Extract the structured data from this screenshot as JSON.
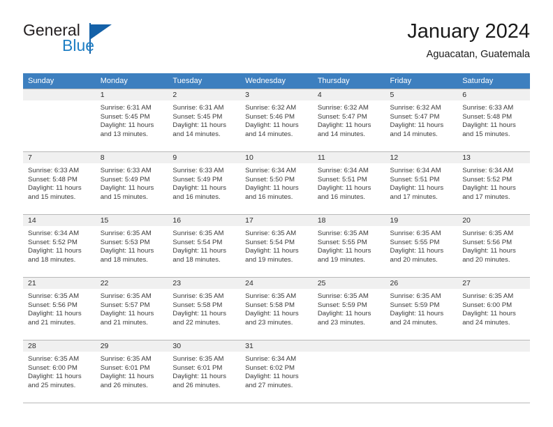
{
  "brand": {
    "name_part1": "General",
    "name_part2": "Blue",
    "logo_icon": "triangle-flag-icon"
  },
  "header": {
    "title": "January 2024",
    "location": "Aguacatan, Guatemala"
  },
  "calendar": {
    "weekday_headers": [
      "Sunday",
      "Monday",
      "Tuesday",
      "Wednesday",
      "Thursday",
      "Friday",
      "Saturday"
    ],
    "accent_color": "#3d7fbf",
    "daynum_strip_color": "#f0f0f0",
    "border_color": "#b8b8b8",
    "weeks": [
      [
        {
          "day": "",
          "sunrise": "",
          "sunset": "",
          "daylight_line1": "",
          "daylight_line2": ""
        },
        {
          "day": "1",
          "sunrise": "Sunrise: 6:31 AM",
          "sunset": "Sunset: 5:45 PM",
          "daylight_line1": "Daylight: 11 hours",
          "daylight_line2": "and 13 minutes."
        },
        {
          "day": "2",
          "sunrise": "Sunrise: 6:31 AM",
          "sunset": "Sunset: 5:45 PM",
          "daylight_line1": "Daylight: 11 hours",
          "daylight_line2": "and 14 minutes."
        },
        {
          "day": "3",
          "sunrise": "Sunrise: 6:32 AM",
          "sunset": "Sunset: 5:46 PM",
          "daylight_line1": "Daylight: 11 hours",
          "daylight_line2": "and 14 minutes."
        },
        {
          "day": "4",
          "sunrise": "Sunrise: 6:32 AM",
          "sunset": "Sunset: 5:47 PM",
          "daylight_line1": "Daylight: 11 hours",
          "daylight_line2": "and 14 minutes."
        },
        {
          "day": "5",
          "sunrise": "Sunrise: 6:32 AM",
          "sunset": "Sunset: 5:47 PM",
          "daylight_line1": "Daylight: 11 hours",
          "daylight_line2": "and 14 minutes."
        },
        {
          "day": "6",
          "sunrise": "Sunrise: 6:33 AM",
          "sunset": "Sunset: 5:48 PM",
          "daylight_line1": "Daylight: 11 hours",
          "daylight_line2": "and 15 minutes."
        }
      ],
      [
        {
          "day": "7",
          "sunrise": "Sunrise: 6:33 AM",
          "sunset": "Sunset: 5:48 PM",
          "daylight_line1": "Daylight: 11 hours",
          "daylight_line2": "and 15 minutes."
        },
        {
          "day": "8",
          "sunrise": "Sunrise: 6:33 AM",
          "sunset": "Sunset: 5:49 PM",
          "daylight_line1": "Daylight: 11 hours",
          "daylight_line2": "and 15 minutes."
        },
        {
          "day": "9",
          "sunrise": "Sunrise: 6:33 AM",
          "sunset": "Sunset: 5:49 PM",
          "daylight_line1": "Daylight: 11 hours",
          "daylight_line2": "and 16 minutes."
        },
        {
          "day": "10",
          "sunrise": "Sunrise: 6:34 AM",
          "sunset": "Sunset: 5:50 PM",
          "daylight_line1": "Daylight: 11 hours",
          "daylight_line2": "and 16 minutes."
        },
        {
          "day": "11",
          "sunrise": "Sunrise: 6:34 AM",
          "sunset": "Sunset: 5:51 PM",
          "daylight_line1": "Daylight: 11 hours",
          "daylight_line2": "and 16 minutes."
        },
        {
          "day": "12",
          "sunrise": "Sunrise: 6:34 AM",
          "sunset": "Sunset: 5:51 PM",
          "daylight_line1": "Daylight: 11 hours",
          "daylight_line2": "and 17 minutes."
        },
        {
          "day": "13",
          "sunrise": "Sunrise: 6:34 AM",
          "sunset": "Sunset: 5:52 PM",
          "daylight_line1": "Daylight: 11 hours",
          "daylight_line2": "and 17 minutes."
        }
      ],
      [
        {
          "day": "14",
          "sunrise": "Sunrise: 6:34 AM",
          "sunset": "Sunset: 5:52 PM",
          "daylight_line1": "Daylight: 11 hours",
          "daylight_line2": "and 18 minutes."
        },
        {
          "day": "15",
          "sunrise": "Sunrise: 6:35 AM",
          "sunset": "Sunset: 5:53 PM",
          "daylight_line1": "Daylight: 11 hours",
          "daylight_line2": "and 18 minutes."
        },
        {
          "day": "16",
          "sunrise": "Sunrise: 6:35 AM",
          "sunset": "Sunset: 5:54 PM",
          "daylight_line1": "Daylight: 11 hours",
          "daylight_line2": "and 18 minutes."
        },
        {
          "day": "17",
          "sunrise": "Sunrise: 6:35 AM",
          "sunset": "Sunset: 5:54 PM",
          "daylight_line1": "Daylight: 11 hours",
          "daylight_line2": "and 19 minutes."
        },
        {
          "day": "18",
          "sunrise": "Sunrise: 6:35 AM",
          "sunset": "Sunset: 5:55 PM",
          "daylight_line1": "Daylight: 11 hours",
          "daylight_line2": "and 19 minutes."
        },
        {
          "day": "19",
          "sunrise": "Sunrise: 6:35 AM",
          "sunset": "Sunset: 5:55 PM",
          "daylight_line1": "Daylight: 11 hours",
          "daylight_line2": "and 20 minutes."
        },
        {
          "day": "20",
          "sunrise": "Sunrise: 6:35 AM",
          "sunset": "Sunset: 5:56 PM",
          "daylight_line1": "Daylight: 11 hours",
          "daylight_line2": "and 20 minutes."
        }
      ],
      [
        {
          "day": "21",
          "sunrise": "Sunrise: 6:35 AM",
          "sunset": "Sunset: 5:56 PM",
          "daylight_line1": "Daylight: 11 hours",
          "daylight_line2": "and 21 minutes."
        },
        {
          "day": "22",
          "sunrise": "Sunrise: 6:35 AM",
          "sunset": "Sunset: 5:57 PM",
          "daylight_line1": "Daylight: 11 hours",
          "daylight_line2": "and 21 minutes."
        },
        {
          "day": "23",
          "sunrise": "Sunrise: 6:35 AM",
          "sunset": "Sunset: 5:58 PM",
          "daylight_line1": "Daylight: 11 hours",
          "daylight_line2": "and 22 minutes."
        },
        {
          "day": "24",
          "sunrise": "Sunrise: 6:35 AM",
          "sunset": "Sunset: 5:58 PM",
          "daylight_line1": "Daylight: 11 hours",
          "daylight_line2": "and 23 minutes."
        },
        {
          "day": "25",
          "sunrise": "Sunrise: 6:35 AM",
          "sunset": "Sunset: 5:59 PM",
          "daylight_line1": "Daylight: 11 hours",
          "daylight_line2": "and 23 minutes."
        },
        {
          "day": "26",
          "sunrise": "Sunrise: 6:35 AM",
          "sunset": "Sunset: 5:59 PM",
          "daylight_line1": "Daylight: 11 hours",
          "daylight_line2": "and 24 minutes."
        },
        {
          "day": "27",
          "sunrise": "Sunrise: 6:35 AM",
          "sunset": "Sunset: 6:00 PM",
          "daylight_line1": "Daylight: 11 hours",
          "daylight_line2": "and 24 minutes."
        }
      ],
      [
        {
          "day": "28",
          "sunrise": "Sunrise: 6:35 AM",
          "sunset": "Sunset: 6:00 PM",
          "daylight_line1": "Daylight: 11 hours",
          "daylight_line2": "and 25 minutes."
        },
        {
          "day": "29",
          "sunrise": "Sunrise: 6:35 AM",
          "sunset": "Sunset: 6:01 PM",
          "daylight_line1": "Daylight: 11 hours",
          "daylight_line2": "and 26 minutes."
        },
        {
          "day": "30",
          "sunrise": "Sunrise: 6:35 AM",
          "sunset": "Sunset: 6:01 PM",
          "daylight_line1": "Daylight: 11 hours",
          "daylight_line2": "and 26 minutes."
        },
        {
          "day": "31",
          "sunrise": "Sunrise: 6:34 AM",
          "sunset": "Sunset: 6:02 PM",
          "daylight_line1": "Daylight: 11 hours",
          "daylight_line2": "and 27 minutes."
        },
        {
          "day": "",
          "sunrise": "",
          "sunset": "",
          "daylight_line1": "",
          "daylight_line2": ""
        },
        {
          "day": "",
          "sunrise": "",
          "sunset": "",
          "daylight_line1": "",
          "daylight_line2": ""
        },
        {
          "day": "",
          "sunrise": "",
          "sunset": "",
          "daylight_line1": "",
          "daylight_line2": ""
        }
      ]
    ]
  }
}
